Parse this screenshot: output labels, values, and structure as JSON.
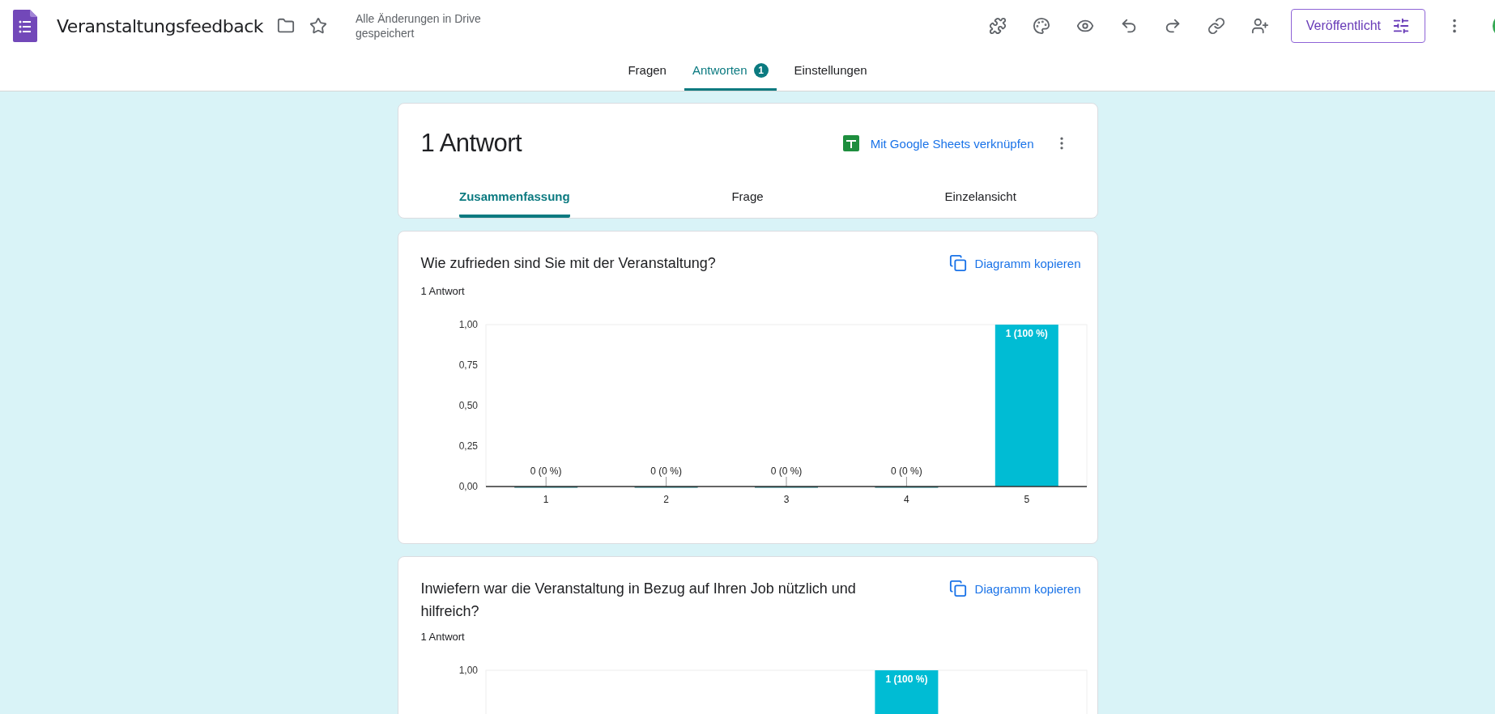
{
  "header": {
    "title": "Veranstaltungsfeedback",
    "save_status": "Alle Änderungen in Drive gespeichert",
    "publish_button": "Veröffentlicht"
  },
  "tabs": [
    {
      "label": "Fragen",
      "selected": false
    },
    {
      "label": "Antworten",
      "selected": true,
      "badge": "1"
    },
    {
      "label": "Einstellungen",
      "selected": false
    }
  ],
  "summary": {
    "title": "1 Antwort",
    "sheets_link": "Mit Google Sheets verknüpfen",
    "tabs": [
      {
        "label": "Zusammenfassung",
        "selected": true
      },
      {
        "label": "Frage",
        "selected": false
      },
      {
        "label": "Einzelansicht",
        "selected": false
      }
    ]
  },
  "questions": [
    {
      "title": "Wie zufrieden sind Sie mit der Veranstaltung?",
      "copy_button": "Diagramm kopieren",
      "count": "1 Antwort",
      "chart_data": {
        "type": "bar",
        "categories": [
          "1",
          "2",
          "3",
          "4",
          "5"
        ],
        "values": [
          0,
          0,
          0,
          0,
          1
        ],
        "ylim": [
          0,
          1
        ],
        "yticks": [
          {
            "value": 0,
            "label": "0,00"
          },
          {
            "value": 0.25,
            "label": "0,25"
          },
          {
            "value": 0.5,
            "label": "0,50"
          },
          {
            "value": 0.75,
            "label": "0,75"
          },
          {
            "value": 1,
            "label": "1,00"
          }
        ],
        "value_labels": [
          "0 (0 %)",
          "0 (0 %)",
          "0 (0 %)",
          "0 (0 %)",
          "1 (100 %)"
        ]
      }
    },
    {
      "title": "Inwiefern war die Veranstaltung in Bezug auf Ihren Job nützlich und hilfreich?",
      "copy_button": "Diagramm kopieren",
      "count": "1 Antwort",
      "chart_data": {
        "type": "bar",
        "values": [
          null,
          null,
          null,
          1,
          null
        ],
        "ylim": [
          0,
          1
        ],
        "yticks": [
          {
            "value": 1,
            "label": "1,00"
          }
        ],
        "value_labels": [
          null,
          null,
          null,
          "1 (100 %)",
          null
        ]
      }
    }
  ]
}
